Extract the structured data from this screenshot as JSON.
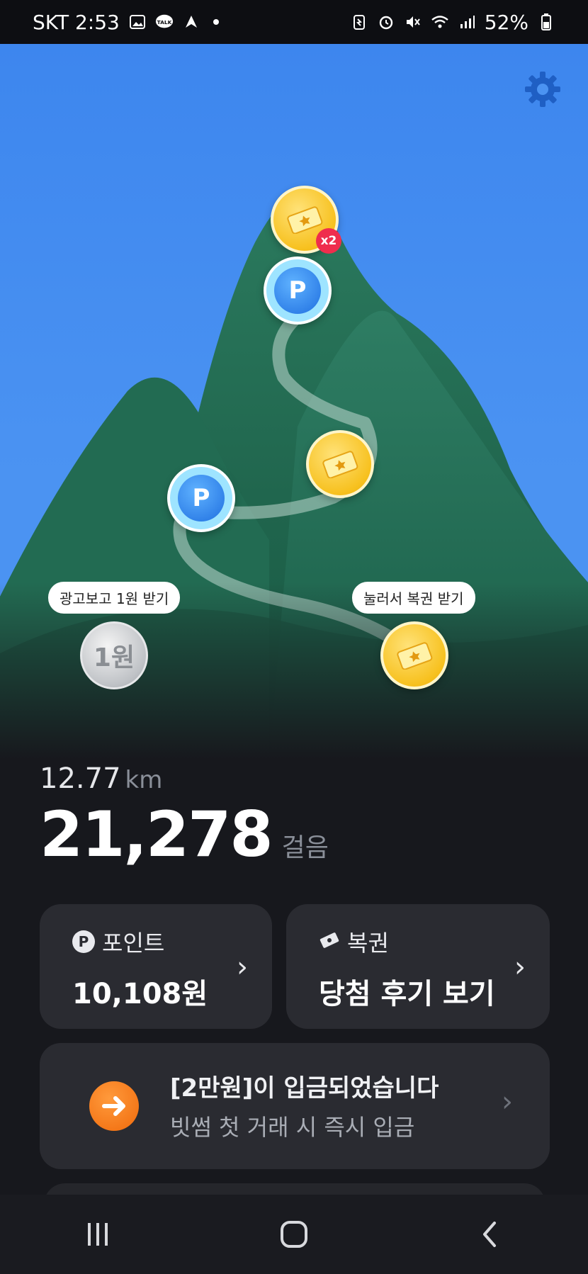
{
  "status_bar": {
    "carrier_time": "SKT 2:53",
    "battery": "52%",
    "left_icons": [
      "gallery-icon",
      "kakaotalk-icon",
      "app-icon"
    ],
    "right_icons": [
      "battery-saver-icon",
      "alarm-icon",
      "mute-icon",
      "wifi-icon",
      "signal-icon"
    ]
  },
  "scene": {
    "sky_color": "#4b93f2",
    "mountain_color": "#1f6a4f",
    "markers": [
      {
        "type": "ticket",
        "badge": "x2"
      },
      {
        "type": "point",
        "label": "P"
      },
      {
        "type": "ticket"
      },
      {
        "type": "point",
        "label": "P"
      },
      {
        "type": "ticket"
      }
    ],
    "ad_pill": "광고보고 1원 받기",
    "ad_coin": "1원",
    "tap_pill": "눌러서 복권 받기"
  },
  "stats": {
    "distance_value": "12.77",
    "distance_unit": "km",
    "steps_value": "21,278",
    "steps_unit": "걸음"
  },
  "cards": {
    "points": {
      "icon": "P",
      "label": "포인트",
      "value": "10,108원"
    },
    "lottery": {
      "label": "복권",
      "value": "당첨 후기 보기"
    },
    "promo": {
      "title": "[2만원]이 입금되었습니다",
      "subtitle": "빗썸 첫 거래 시 즉시 입금"
    }
  },
  "nav": [
    "recent-apps",
    "home",
    "back"
  ],
  "colors": {
    "accent_orange": "#f06a0b",
    "point_blue": "#1f6fe0",
    "ticket_yellow": "#f7c11f",
    "badge_red": "#ef2d4d"
  }
}
